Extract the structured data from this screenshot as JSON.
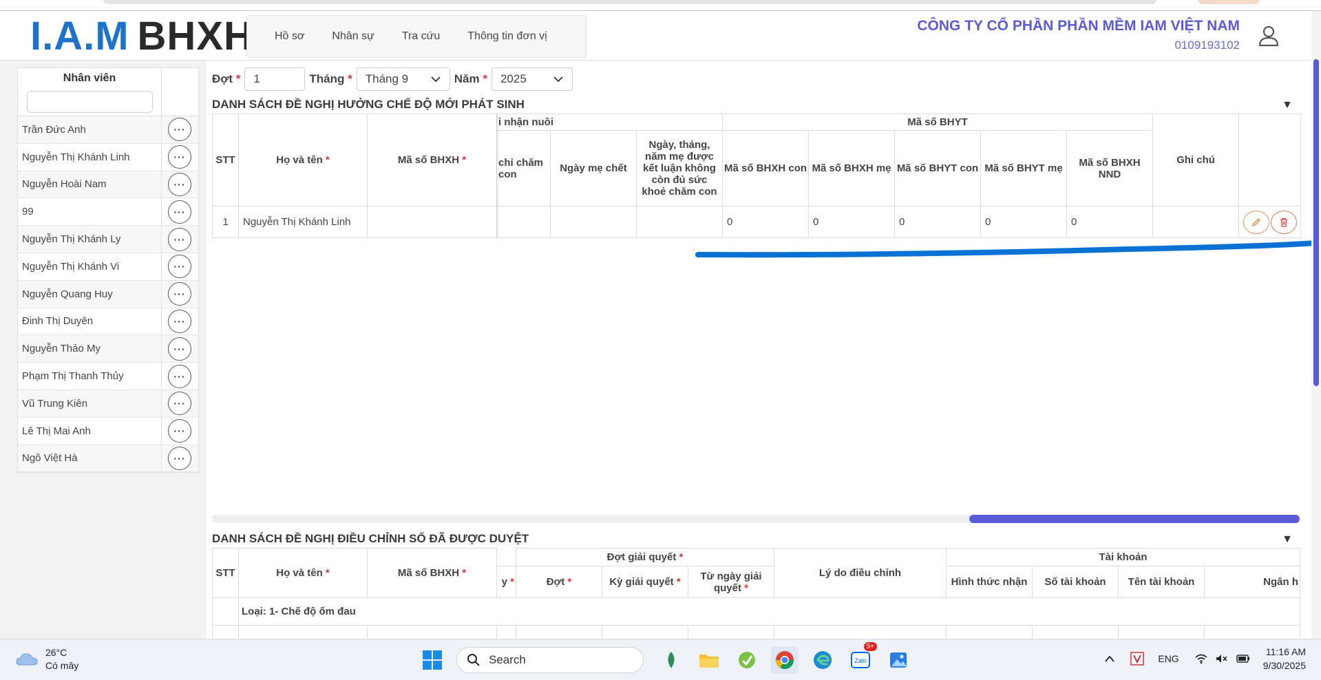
{
  "header": {
    "logo_iam": "I.A.M",
    "logo_bhxh": "BHXH",
    "nav": [
      "Hồ sơ",
      "Nhân sự",
      "Tra cứu",
      "Thông tin đơn vị"
    ],
    "company_name": "CÔNG TY CỔ PHẦN PHẦN MỀM IAM VIỆT NAM",
    "company_code": "0109193102"
  },
  "sidebar": {
    "title": "Nhân viên",
    "dots": "···",
    "employees": [
      "Trần Đức Anh",
      "Nguyễn Thị Khánh Linh",
      "Nguyễn Hoài Nam",
      "99",
      "Nguyễn Thị Khánh Ly",
      "Nguyễn Thị Khánh Vi",
      "Nguyễn Quang Huy",
      "Đinh Thị Duyên",
      "Nguyễn Thảo My",
      "Phạm Thị Thanh Thủy",
      "Vũ Trung Kiên",
      "Lê Thị Mai Anh",
      "Ngô Việt Hà"
    ]
  },
  "filters": {
    "dot_label": "Đợt",
    "dot_value": "1",
    "thang_label": "Tháng",
    "thang_value": "Tháng 9",
    "nam_label": "Năm",
    "nam_value": "2025",
    "required": "*"
  },
  "section1": {
    "title": "DANH SÁCH ĐỀ NGHỊ HƯỞNG CHẾ ĐỘ MỚI PHÁT SINH",
    "group_nhannuoi": "i nhận nuôi",
    "group_bhyt": "Mã số BHYT",
    "col_stt": "STT",
    "col_hoten": "Họ và tên",
    "col_bhxh": "Mã số BHXH",
    "col_chicham": "chỉ chăm con",
    "col_ngaymechet": "Ngày mẹ chết",
    "col_ngaythang": "Ngày, tháng, năm mẹ được kết luận không còn đủ sức khoẻ chăm con",
    "col_bhxh_con": "Mã số BHXH con",
    "col_bhxh_me": "Mã số BHXH mẹ",
    "col_bhyt_con": "Mã số BHYT con",
    "col_bhyt_me": "Mã số BHYT mẹ",
    "col_bhxh_nnd": "Mã số BHXH NND",
    "col_ghichu": "Ghi chú",
    "row": {
      "stt": "1",
      "hoten": "Nguyễn Thị Khánh Linh",
      "v1": "0",
      "v2": "0",
      "v3": "0",
      "v4": "0",
      "v5": "0"
    }
  },
  "section2": {
    "title": "DANH SÁCH ĐỀ NGHỊ ĐIỀU CHỈNH SỐ ĐÃ ĐƯỢC DUYỆT",
    "col_stt": "STT",
    "col_hoten": "Họ và tên",
    "col_bhxh": "Mã số BHXH",
    "col_y": "y",
    "group_dot": "Đợt giải quyết",
    "col_dot": "Đợt",
    "col_ky": "Kỳ giải quyết",
    "col_tungay": "Từ ngày giải quyết",
    "col_lydo": "Lý do điều chỉnh",
    "group_taikhoan": "Tài khoản",
    "col_hinhthuc": "Hình thức nhận",
    "col_sotk": "Số tài khoản",
    "col_tentk": "Tên tài khoản",
    "col_nganhang": "Ngân h",
    "loai": "Loại: 1- Chế độ ốm đau"
  },
  "taskbar": {
    "temp": "26°C",
    "weather": "Có mây",
    "search": "Search",
    "zalo_badge": "5+",
    "lang": "ENG",
    "time": "11:16 AM",
    "date": "9/30/2025"
  },
  "colors": {
    "accent": "#5b5bd6",
    "logo_blue": "#1e73c8",
    "annotation": "#0a72d4"
  }
}
